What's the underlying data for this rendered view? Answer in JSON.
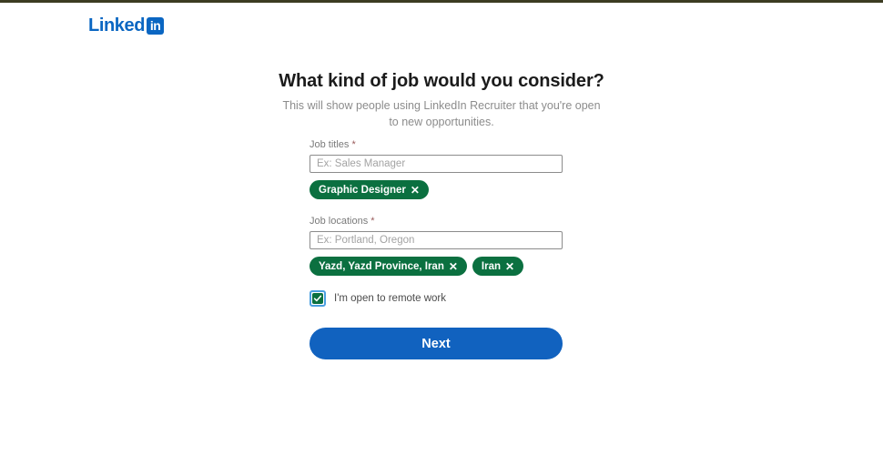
{
  "brand": {
    "word": "Linked",
    "badge": "in"
  },
  "header": {
    "title": "What kind of job would you consider?",
    "subtitle": "This will show people using LinkedIn Recruiter that you're open to new opportunities."
  },
  "form": {
    "job_titles": {
      "label": "Job titles",
      "required_mark": "*",
      "placeholder": "Ex: Sales Manager",
      "value": "",
      "pills": [
        {
          "label": "Graphic Designer",
          "remove": "✕"
        }
      ]
    },
    "job_locations": {
      "label": "Job locations",
      "required_mark": "*",
      "placeholder": "Ex: Portland, Oregon",
      "value": "",
      "pills": [
        {
          "label": "Yazd, Yazd Province, Iran",
          "remove": "✕"
        },
        {
          "label": "Iran",
          "remove": "✕"
        }
      ]
    },
    "remote": {
      "label": "I'm open to remote work",
      "checked": true
    },
    "submit_label": "Next"
  },
  "colors": {
    "brand_blue": "#0a66c2",
    "button_blue": "#1162bf",
    "pill_green": "#0b7040",
    "focus_blue": "#4a9fe0",
    "top_rule": "#3c3c22"
  }
}
